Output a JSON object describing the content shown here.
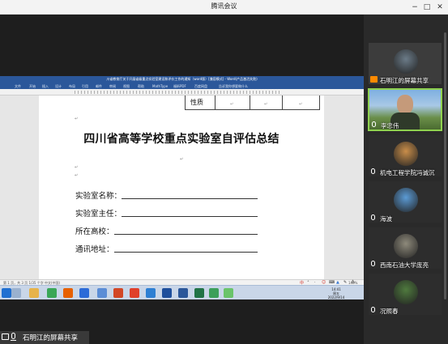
{
  "window": {
    "title": "腾讯会议",
    "min_label": "−",
    "max_label": "□",
    "close_label": "✕"
  },
  "word": {
    "title": "川省教育厅关于开展省级重点实验室建设和评价工作的通知（word版）[兼容模式] - Word(产品激活失败)",
    "tabs": [
      "文件",
      "开始",
      "插入",
      "设计",
      "布局",
      "引用",
      "邮件",
      "审阅",
      "视图",
      "帮助",
      "MathType",
      "福昕PDF",
      "百度网盘",
      "告诉我你想要做什么"
    ],
    "table_label": "性质",
    "heading": "四川省高等学校重点实验室自评估总结",
    "fields": [
      {
        "label": "实验室名称："
      },
      {
        "label": "实验室主任："
      },
      {
        "label": "所在高校："
      },
      {
        "label": "通讯地址："
      }
    ],
    "status_left": "第 1 页，共 3 页   1/35 个字   中文(中国)",
    "zoom": "140%",
    "ime": [
      "中",
      "⁺",
      "·",
      "☺",
      "⌨",
      "▲",
      "✎",
      "⁂"
    ]
  },
  "taskbar": {
    "time": "14:41",
    "weekday": "周五",
    "date": "2022/9/14",
    "apps": [
      {
        "name": "start",
        "color": "#1f6fd1"
      },
      {
        "name": "task-view",
        "color": "#9ab1cf"
      },
      {
        "name": "explorer",
        "color": "#e6b34a"
      },
      {
        "name": "chrome",
        "color": "#3aa757"
      },
      {
        "name": "firefox",
        "color": "#e66000"
      },
      {
        "name": "app-a",
        "color": "#2c6bd8"
      },
      {
        "name": "app-b",
        "color": "#5b8dd6"
      },
      {
        "name": "powerpoint",
        "color": "#d24726"
      },
      {
        "name": "app-c",
        "color": "#e0402a"
      },
      {
        "name": "photos",
        "color": "#2d7fd3"
      },
      {
        "name": "app-d",
        "color": "#1e4f9c"
      },
      {
        "name": "word",
        "color": "#2b579a"
      },
      {
        "name": "excel",
        "color": "#217346"
      },
      {
        "name": "app-e",
        "color": "#3c9f5a"
      },
      {
        "name": "wechat",
        "color": "#6ac46a"
      }
    ]
  },
  "sharer": {
    "label": "石明江的屏幕共享"
  },
  "participants": [
    {
      "name": "石明江的屏幕共享",
      "bg": "#3c3c3c",
      "avatar": "#6b7b88",
      "type": "share",
      "active": false
    },
    {
      "name": "李忠伟",
      "bg": "#7aa0c8",
      "avatar": "#4d6b3a",
      "type": "video",
      "active": true
    },
    {
      "name": "机电工程学院冯诚沉",
      "bg": "#2d2d2d",
      "avatar": "#c98e4a",
      "type": "mic",
      "active": false
    },
    {
      "name": "海波",
      "bg": "#2d2d2d",
      "avatar": "#5b9bd5",
      "type": "mic",
      "active": false
    },
    {
      "name": "西南石油大学庞亮",
      "bg": "#2d2d2d",
      "avatar": "#8e8a7b",
      "type": "mic",
      "active": false
    },
    {
      "name": "况照春",
      "bg": "#2d2d2d",
      "avatar": "#4f7a3e",
      "type": "mic",
      "active": false
    }
  ]
}
